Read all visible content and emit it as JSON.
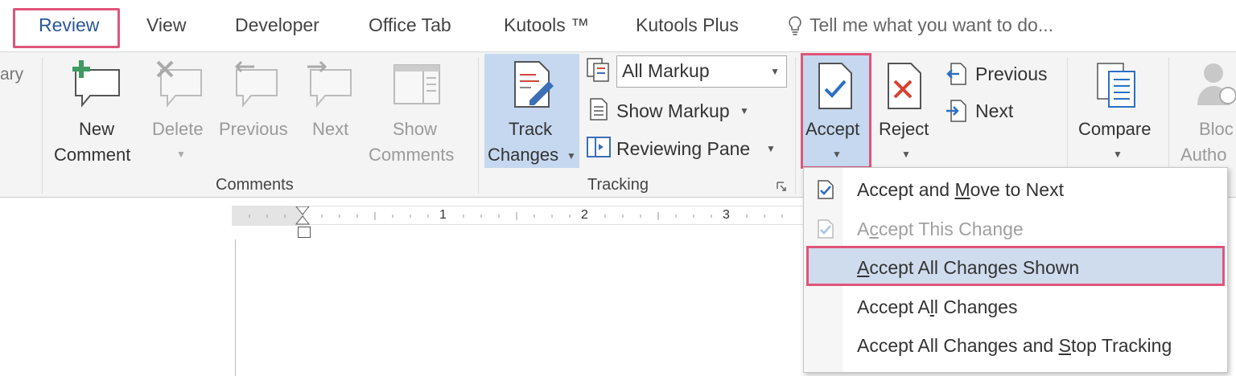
{
  "tabs": {
    "review": "Review",
    "view": "View",
    "developer": "Developer",
    "office_tab": "Office Tab",
    "kutools": "Kutools ™",
    "kutools_plus": "Kutools Plus",
    "tell_me": "Tell me what you want to do..."
  },
  "ribbon": {
    "cut_left_label": "ary",
    "comments": {
      "new_comment_1": "New",
      "new_comment_2": "Comment",
      "delete": "Delete",
      "previous": "Previous",
      "next": "Next",
      "show_comments_1": "Show",
      "show_comments_2": "Comments",
      "group_label": "Comments"
    },
    "tracking": {
      "track_changes_1": "Track",
      "track_changes_2": "Changes",
      "markup_select": "All Markup",
      "show_markup": "Show Markup",
      "reviewing_pane": "Reviewing Pane",
      "group_label": "Tracking"
    },
    "changes": {
      "accept": "Accept",
      "reject": "Reject",
      "previous": "Previous",
      "next": "Next"
    },
    "compare": {
      "compare": "Compare"
    },
    "protect": {
      "block_1": "Bloc",
      "block_2": "Autho"
    }
  },
  "ruler": {
    "n1": "1",
    "n2": "2",
    "n3": "3"
  },
  "accept_menu": {
    "items": [
      {
        "pre": "Accept and ",
        "key": "M",
        "post": "ove to Next"
      },
      {
        "pre": "A",
        "key": "c",
        "post": "cept This Change"
      },
      {
        "pre": "",
        "key": "A",
        "post": "ccept All Changes Shown"
      },
      {
        "pre": "Accept A",
        "key": "l",
        "post": "l Changes"
      },
      {
        "pre": "Accept All Changes and ",
        "key": "S",
        "post": "top Tracking"
      }
    ]
  },
  "colors": {
    "highlight_border": "#e0547a",
    "selected_bg": "#c5d8ef",
    "accent_blue": "#2b579a"
  }
}
